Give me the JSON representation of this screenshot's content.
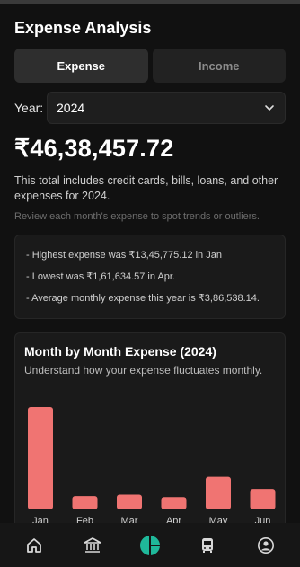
{
  "header": {
    "title": "Expense Analysis"
  },
  "tabs": [
    {
      "label": "Expense",
      "active": true
    },
    {
      "label": "Income",
      "active": false
    }
  ],
  "year": {
    "label": "Year:",
    "value": "2024"
  },
  "summary": {
    "total": "₹46,38,457.72",
    "description": "This total includes credit cards, bills, loans, and other expenses for 2024.",
    "hint": "Review each month's expense to spot trends or outliers."
  },
  "stats": [
    "- Highest expense was ₹13,45,775.12 in Jan",
    "- Lowest was ₹1,61,634.57 in Apr.",
    "- Average monthly expense this year is ₹3,86,538.14."
  ],
  "chart_card": {
    "title": "Month by Month Expense (2024)",
    "subtitle": "Understand how your expense fluctuates monthly."
  },
  "chart_data": {
    "type": "bar",
    "categories": [
      "Jan",
      "Feb",
      "Mar",
      "Apr",
      "May",
      "Jun"
    ],
    "values": [
      1345775.12,
      175000,
      195000,
      161634.57,
      430000,
      270000
    ],
    "ylim": [
      0,
      1345775.12
    ],
    "grid": false,
    "bar_color": "#f07472"
  },
  "bottom_nav": [
    {
      "icon": "home-icon",
      "active": false
    },
    {
      "icon": "bank-icon",
      "active": false
    },
    {
      "icon": "pie-chart-icon",
      "active": true
    },
    {
      "icon": "bus-icon",
      "active": false
    },
    {
      "icon": "profile-icon",
      "active": false
    }
  ],
  "colors": {
    "accent": "#1fb89a",
    "bar": "#f07472",
    "background": "#111111"
  }
}
